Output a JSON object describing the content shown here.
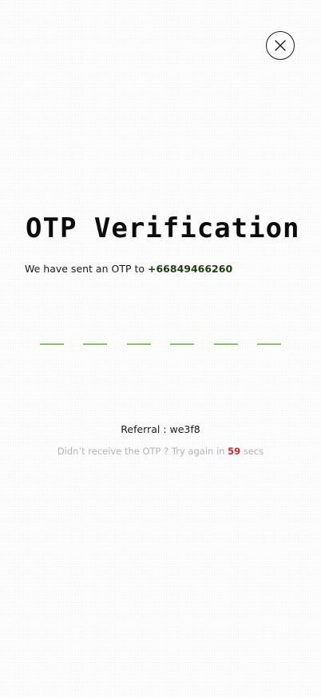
{
  "header": {
    "close_icon": "close-icon"
  },
  "title": "OTP Verification",
  "message": {
    "prefix": "We have sent an OTP to ",
    "phone": "+66849466260"
  },
  "otp": {
    "digits": [
      "",
      "",
      "",
      "",
      "",
      ""
    ],
    "underline_color": "#8cc06a"
  },
  "referral": {
    "label": "Referral : ",
    "code": "we3f8"
  },
  "resend": {
    "prefix": "Didn’t receive the OTP ? Try again in ",
    "seconds": "59",
    "suffix": " secs",
    "countdown_color": "#d62828"
  }
}
